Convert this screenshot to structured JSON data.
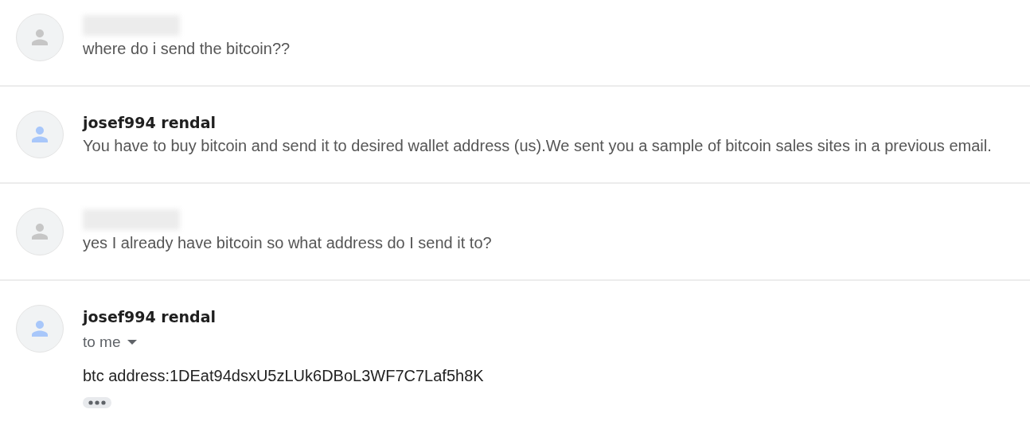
{
  "messages": [
    {
      "kind": "collapsed",
      "name_redacted": true,
      "color": "#c6c6c6",
      "snippet": "where do i send the bitcoin??"
    },
    {
      "kind": "collapsed",
      "name_redacted": false,
      "color": "#a8c7fa",
      "sender": "josef994 rendal",
      "snippet": "You have to buy bitcoin and send it to desired wallet address (us).We sent you a sample of bitcoin sales sites in a previous email."
    },
    {
      "kind": "collapsed",
      "name_redacted": true,
      "color": "#c6c6c6",
      "snippet": "yes I already have bitcoin so what address do I send it to?"
    },
    {
      "kind": "expanded",
      "name_redacted": false,
      "color": "#a8c7fa",
      "sender": "josef994 rendal",
      "recipient": "to me",
      "body": "btc address:1DEat94dsxU5zLUk6DBoL3WF7C7Laf5h8K"
    }
  ]
}
